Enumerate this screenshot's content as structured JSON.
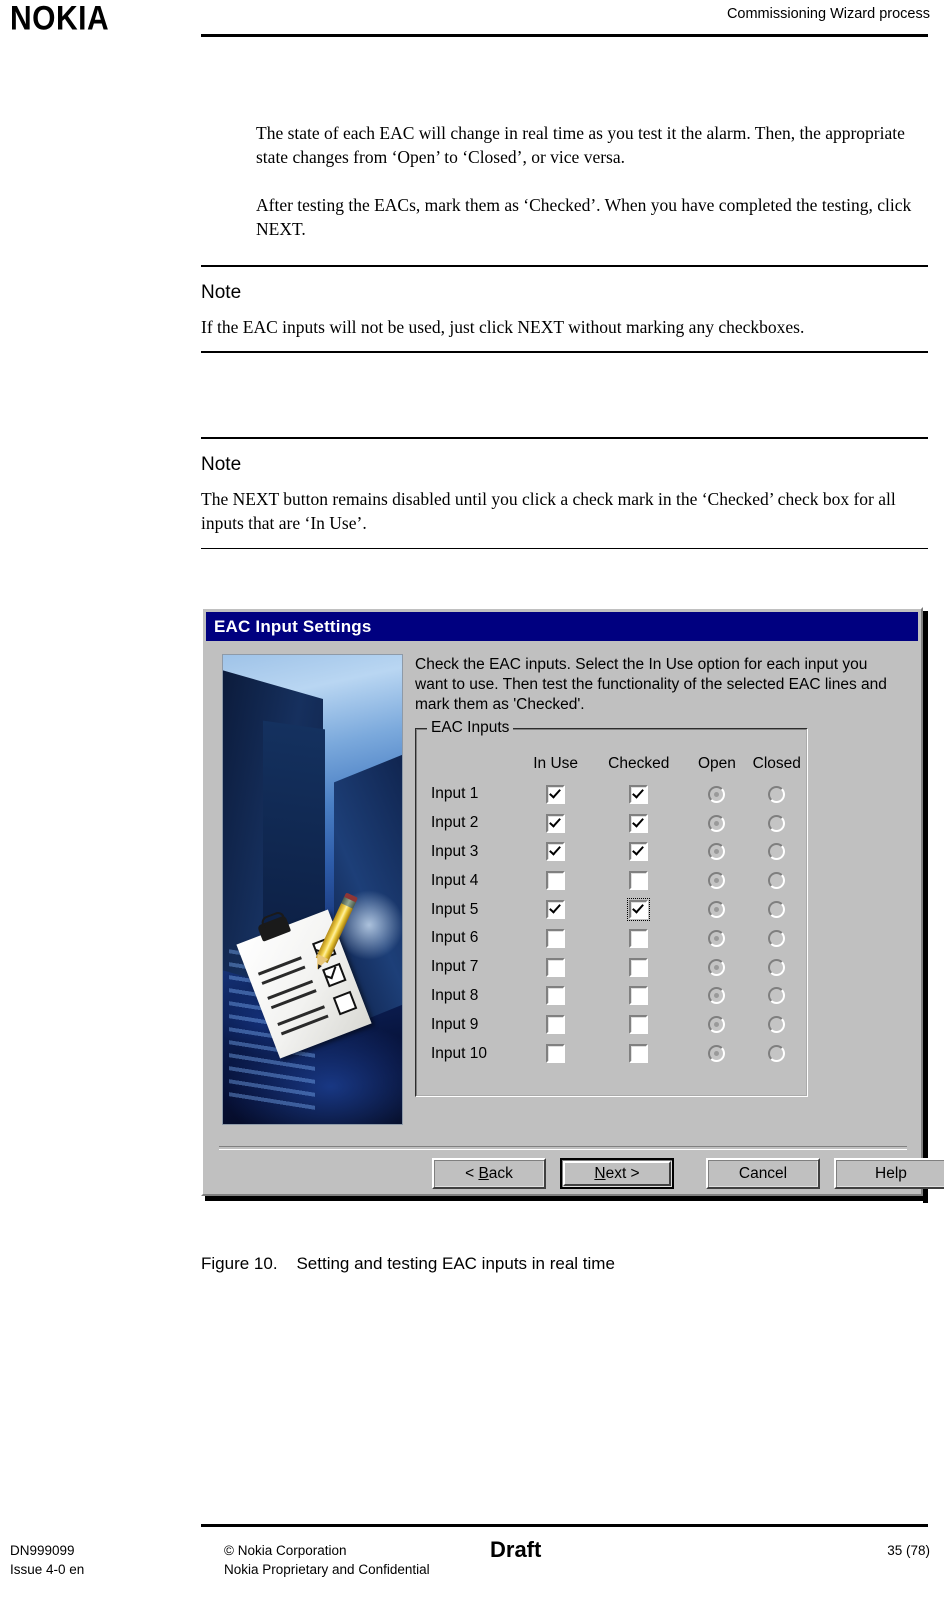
{
  "header": {
    "logo": "NOKIA",
    "title": "Commissioning Wizard process"
  },
  "body": {
    "paragraph_1": "The state of each EAC will change in real time as you test it the alarm. Then, the appropriate state changes from ‘Open’ to ‘Closed’, or vice versa.",
    "paragraph_2": "After testing the EACs, mark them as ‘Checked’. When you have completed the testing, click NEXT.",
    "notes": [
      {
        "title": "Note",
        "text": "If the EAC inputs will not be used, just click NEXT without marking any checkboxes."
      },
      {
        "title": "Note",
        "text": "The NEXT button remains disabled until you click a check mark in the ‘Checked’ check box for all inputs that are ‘In Use’."
      }
    ]
  },
  "dialog": {
    "title": "EAC Input Settings",
    "instructions": "Check the EAC inputs. Select the In Use option for each input you want to use. Then test the functionality of the selected EAC lines and mark them as 'Checked'.",
    "group": {
      "legend": "EAC Inputs",
      "headers": {
        "label": "",
        "in_use": "In Use",
        "checked": "Checked",
        "open": "Open",
        "closed": "Closed"
      },
      "rows": [
        {
          "label": "Input 1",
          "in_use": true,
          "checked": true,
          "state": "Open",
          "checked_focused": false
        },
        {
          "label": "Input 2",
          "in_use": true,
          "checked": true,
          "state": "Open",
          "checked_focused": false
        },
        {
          "label": "Input 3",
          "in_use": true,
          "checked": true,
          "state": "Open",
          "checked_focused": false
        },
        {
          "label": "Input 4",
          "in_use": false,
          "checked": false,
          "state": "Open",
          "checked_focused": false
        },
        {
          "label": "Input 5",
          "in_use": true,
          "checked": true,
          "state": "Open",
          "checked_focused": true
        },
        {
          "label": "Input 6",
          "in_use": false,
          "checked": false,
          "state": "Open",
          "checked_focused": false
        },
        {
          "label": "Input 7",
          "in_use": false,
          "checked": false,
          "state": "Open",
          "checked_focused": false
        },
        {
          "label": "Input 8",
          "in_use": false,
          "checked": false,
          "state": "Open",
          "checked_focused": false
        },
        {
          "label": "Input 9",
          "in_use": false,
          "checked": false,
          "state": "Open",
          "checked_focused": false
        },
        {
          "label": "Input 10",
          "in_use": false,
          "checked": false,
          "state": "Open",
          "checked_focused": false
        }
      ]
    },
    "buttons": {
      "back": "< Back",
      "next": "Next >",
      "cancel": "Cancel",
      "help": "Help"
    },
    "colors": {
      "titlebar": "#000080",
      "face": "#c0c0c0",
      "titlebar_text": "#ffffff"
    }
  },
  "figure": {
    "number": "Figure 10.",
    "caption": "Setting and testing EAC inputs in real time"
  },
  "footer": {
    "doc_id": "DN999099",
    "issue": "Issue 4-0 en",
    "copyright": "© Nokia Corporation",
    "confidentiality": "Nokia Proprietary and Confidential",
    "status": "Draft",
    "page": "35 (78)"
  }
}
